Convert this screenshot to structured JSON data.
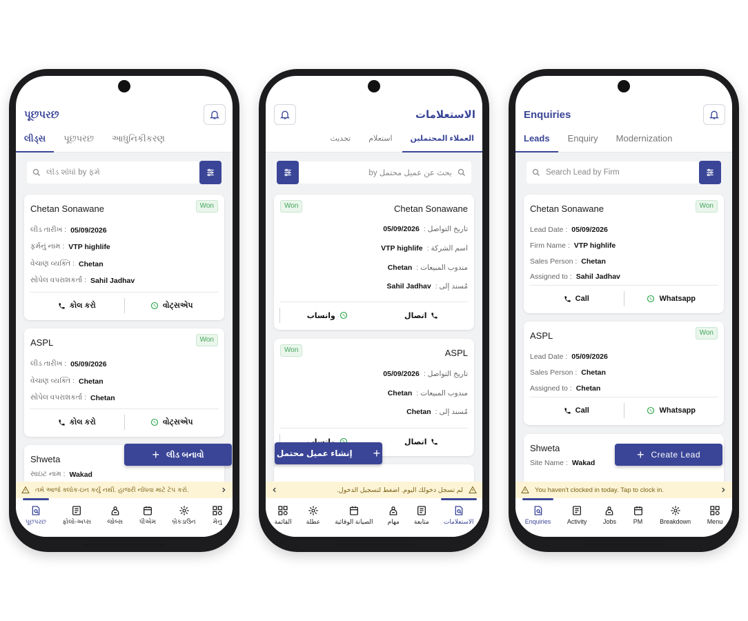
{
  "colors": {
    "primary": "#3a4597",
    "won_text": "#41a55b",
    "won_bg": "#eaf6ec",
    "banner_bg": "#fdf4d6",
    "banner_text": "#7a6317"
  },
  "icons": {
    "bell": "bell-icon",
    "search": "search-icon",
    "filter": "sliders-icon",
    "call": "phone-icon",
    "whatsapp": "whatsapp-icon",
    "warning": "warning-icon",
    "chevron": "chevron-icon"
  },
  "gujarati": {
    "title": "પૂછપરછ",
    "tabs": [
      "લીડ્સ",
      "પૂછપરછ",
      "આધુનિકીકરણ"
    ],
    "search_placeholder": "લીડ શોધો by ફર્મ",
    "cards": [
      {
        "name": "Chetan Sonawane",
        "status": "Won",
        "fields": [
          {
            "label": "લીડ તારીખ :",
            "value": "05/09/2026"
          },
          {
            "label": "ફર્મનું નામ :",
            "value": "VTP highlife"
          },
          {
            "label": "વેચાણ વ્યક્તિ :",
            "value": "Chetan"
          },
          {
            "label": "સોંપેલ વપરાશકર્તા :",
            "value": "Sahil Jadhav"
          }
        ],
        "call": "કોલ કરો",
        "whatsapp": "વોટ્સએપ"
      },
      {
        "name": "ASPL",
        "status": "Won",
        "fields": [
          {
            "label": "લીડ તારીખ :",
            "value": "05/09/2026"
          },
          {
            "label": "વેચાણ વ્યક્તિ :",
            "value": "Chetan"
          },
          {
            "label": "સોંપેલ વપરાશકર્તા :",
            "value": "Chetan"
          }
        ],
        "call": "કોલ કરો",
        "whatsapp": "વોટ્સએપ"
      },
      {
        "name": "Shweta",
        "fields": [
          {
            "label": "સાઇટ નામ :",
            "value": "Wakad"
          }
        ]
      }
    ],
    "fab": "લીડ બનાવો",
    "banner": "તમે આજે ક્લોક-ઇન કર્યું નથી. હાજરી નોંધવા માટે ટેપ કરો.",
    "nav": [
      "પૂછપરછ",
      "ફોલો-અપ્સ",
      "જોબ્સ",
      "પીએમ",
      "બ્રેકડાઉન",
      "મેનુ"
    ]
  },
  "arabic": {
    "title": "الاستعلامات",
    "tabs": [
      "العملاء المحتملين",
      "استعلام",
      "تحديث"
    ],
    "search_placeholder": "بحث عن عميل محتمل by",
    "cards": [
      {
        "name": "Chetan Sonawane",
        "status": "Won",
        "fields": [
          {
            "label": "تاريخ التواصل :",
            "value": "05/09/2026"
          },
          {
            "label": "اسم الشركة :",
            "value": "VTP highlife"
          },
          {
            "label": "مندوب المبيعات :",
            "value": "Chetan"
          },
          {
            "label": "مُسند إلى :",
            "value": "Sahil Jadhav"
          }
        ],
        "call": "اتصال",
        "whatsapp": "واتساب"
      },
      {
        "name": "ASPL",
        "status": "Won",
        "fields": [
          {
            "label": "تاريخ التواصل :",
            "value": "05/09/2026"
          },
          {
            "label": "مندوب المبيعات :",
            "value": "Chetan"
          },
          {
            "label": "مُسند إلى :",
            "value": "Chetan"
          }
        ],
        "call": "اتصال",
        "whatsapp": "واتساب"
      }
    ],
    "fab": "إنشاء عميل محتمل",
    "banner": "لم تسجل دخولك اليوم. اضغط لتسجيل الدخول.",
    "nav": [
      "الاستعلامات",
      "متابعة",
      "مهام",
      "الصيانة الوقائية",
      "عطلة",
      "القائمة"
    ]
  },
  "english": {
    "title": "Enquiries",
    "tabs": [
      "Leads",
      "Enquiry",
      "Modernization"
    ],
    "search_placeholder": "Search Lead by Firm",
    "cards": [
      {
        "name": "Chetan Sonawane",
        "status": "Won",
        "fields": [
          {
            "label": "Lead Date :",
            "value": "05/09/2026"
          },
          {
            "label": "Firm Name :",
            "value": "VTP highlife"
          },
          {
            "label": "Sales Person :",
            "value": "Chetan"
          },
          {
            "label": "Assigned to :",
            "value": "Sahil Jadhav"
          }
        ],
        "call": "Call",
        "whatsapp": "Whatsapp"
      },
      {
        "name": "ASPL",
        "status": "Won",
        "fields": [
          {
            "label": "Lead Date :",
            "value": "05/09/2026"
          },
          {
            "label": "Sales Person :",
            "value": "Chetan"
          },
          {
            "label": "Assigned to :",
            "value": "Chetan"
          }
        ],
        "call": "Call",
        "whatsapp": "Whatsapp"
      },
      {
        "name": "Shweta",
        "fields": [
          {
            "label": "Site Name :",
            "value": "Wakad"
          }
        ]
      }
    ],
    "fab": "Create Lead",
    "banner": "You haven't clocked in today. Tap to clock in.",
    "nav": [
      "Enquiries",
      "Activity",
      "Jobs",
      "PM",
      "Breakdown",
      "Menu"
    ]
  }
}
